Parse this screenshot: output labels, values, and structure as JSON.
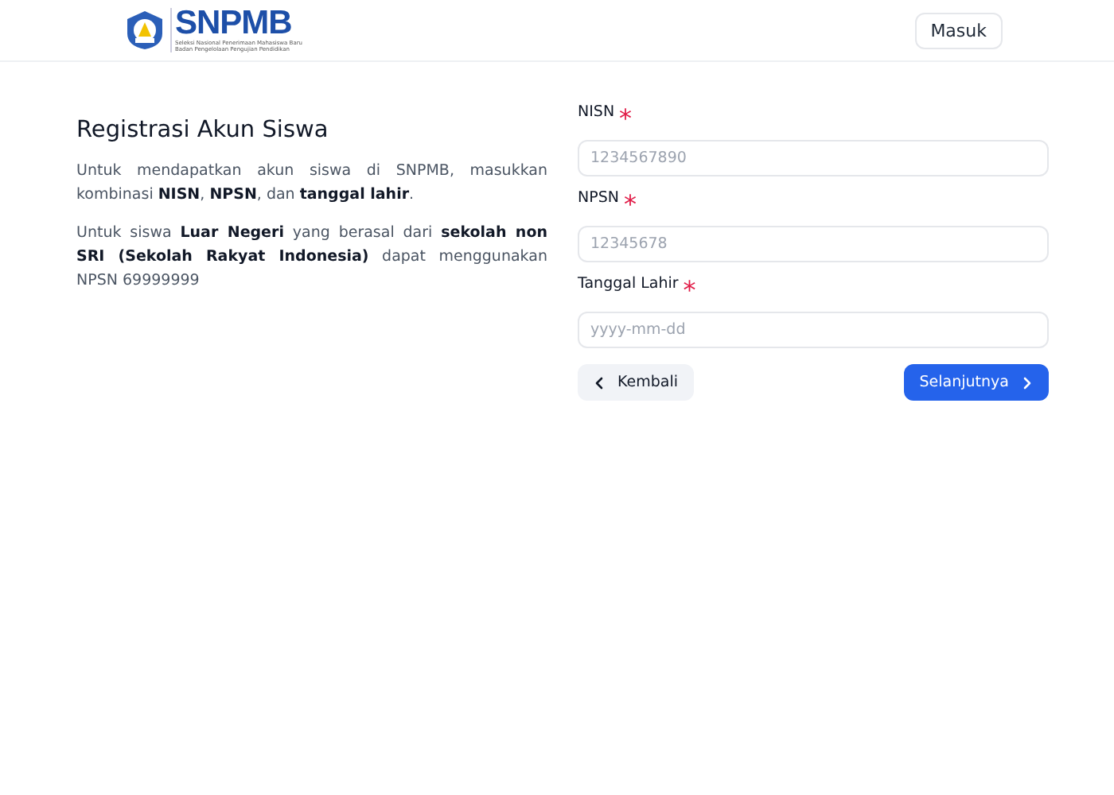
{
  "header": {
    "logo": {
      "name": "SNPMB",
      "tagline": "Seleksi Nasional Penerimaan Mahasiswa Baru",
      "agency": "Badan Pengelolaan Pengujian Pendidikan"
    },
    "login_button": "Masuk"
  },
  "intro": {
    "title": "Registrasi Akun Siswa",
    "paragraphs": [
      "Untuk mendapatkan akun siswa di SNPMB, masukkan kombinasi **NISN**, **NPSN**, dan **tanggal lahir**.",
      "Untuk siswa **Luar Negeri** yang berasal dari **sekolah non SRI (Sekolah Rakyat Indonesia)** dapat menggunakan NPSN 69999999"
    ]
  },
  "form": {
    "fields": [
      {
        "label": "NISN",
        "required_mark": "*",
        "placeholder": "1234567890"
      },
      {
        "label": "NPSN",
        "required_mark": "*",
        "placeholder": "12345678"
      },
      {
        "label": "Tanggal Lahir",
        "required_mark": "*",
        "placeholder": "yyyy-mm-dd"
      }
    ],
    "back_button": "Kembali",
    "next_button": "Selanjutnya"
  }
}
